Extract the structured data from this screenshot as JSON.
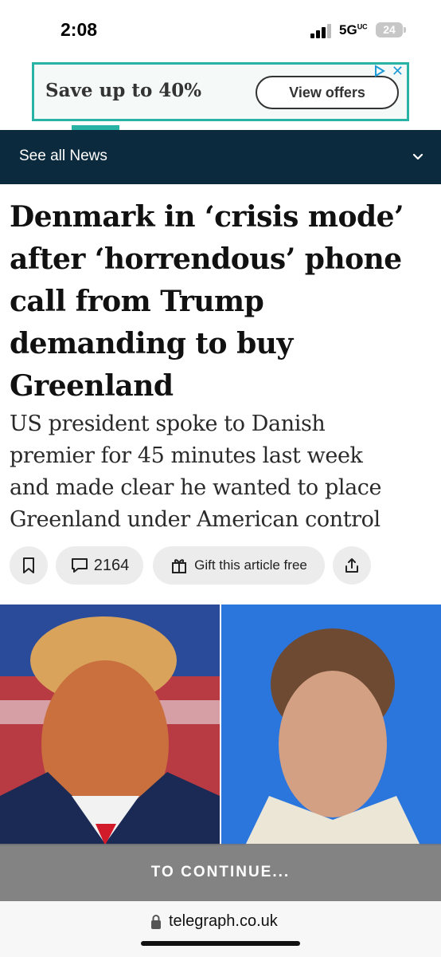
{
  "status_bar": {
    "time": "2:08",
    "network": "5G",
    "network_super": "UC",
    "battery": "24"
  },
  "ad": {
    "text": "Save up to 40%",
    "button": "View offers",
    "choices_icon": "adchoices-icon",
    "close": "✕"
  },
  "nav": {
    "label": "See all News",
    "icon": "chevron-down-icon"
  },
  "article": {
    "headline_lines": [
      "Denmark in ‘crisis mode’",
      "after ‘horrendous’ phone",
      "call from Trump",
      "demanding to buy",
      "Greenland"
    ],
    "standfirst_lines": [
      "US president spoke to Danish",
      "premier for 45 minutes last week",
      "and made clear he wanted to place",
      "Greenland under American control"
    ]
  },
  "actions": {
    "bookmark_icon": "bookmark-icon",
    "comments_count": "2164",
    "gift_label": "Gift this article free",
    "share_icon": "share-icon"
  },
  "overlay": {
    "continue_label": "TO CONTINUE..."
  },
  "browser": {
    "url": "telegraph.co.uk"
  },
  "colors": {
    "nav_bg": "#0c2a3e",
    "accent": "#29b3a5",
    "ad_link": "#1e9bd7"
  }
}
